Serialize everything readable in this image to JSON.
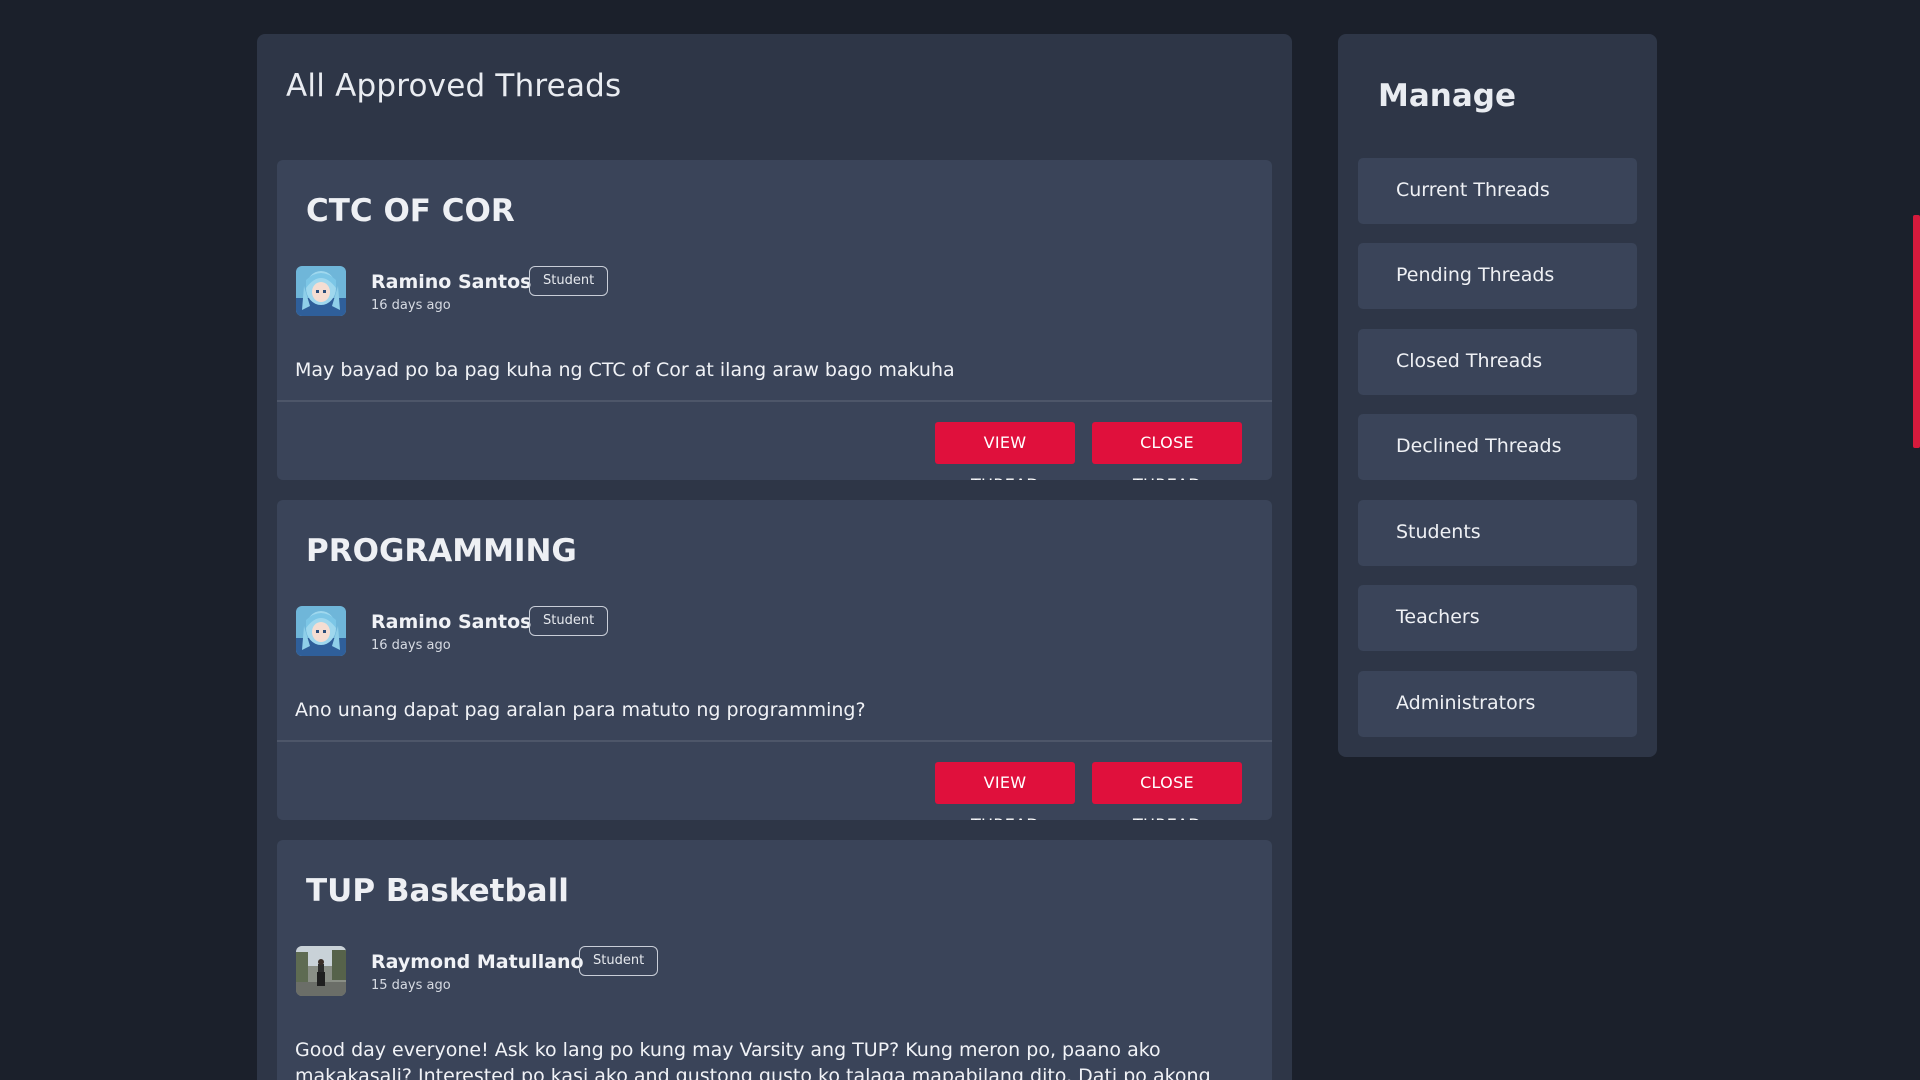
{
  "main": {
    "title": "All Approved Threads",
    "threads": [
      {
        "title": "CTC OF COR",
        "author": "Ramino Santos",
        "role": "Student",
        "time": "16 days ago",
        "body": "May bayad po ba pag kuha ng CTC of Cor at ilang araw bago makuha",
        "view_label": "VIEW THREAD",
        "close_label": "CLOSE THREAD"
      },
      {
        "title": "PROGRAMMING",
        "author": "Ramino Santos",
        "role": "Student",
        "time": "16 days ago",
        "body": "Ano unang dapat pag aralan para matuto ng programming?",
        "view_label": "VIEW THREAD",
        "close_label": "CLOSE THREAD"
      },
      {
        "title": "TUP Basketball",
        "author": "Raymond Matullano",
        "role": "Student",
        "time": "15 days ago",
        "body": "Good day everyone! Ask ko lang po kung may Varsity ang TUP? Kung meron po, paano ako makakasali? Interested po kasi ako and gustong gusto ko talaga mapabilang dito. Dati po akong"
      }
    ]
  },
  "sidebar": {
    "title": "Manage",
    "items": [
      {
        "label": "Current Threads"
      },
      {
        "label": "Pending Threads"
      },
      {
        "label": "Closed Threads"
      },
      {
        "label": "Declined Threads"
      },
      {
        "label": "Students"
      },
      {
        "label": "Teachers"
      },
      {
        "label": "Administrators"
      }
    ]
  },
  "colors": {
    "background": "#1b202b",
    "panel": "#2e3647",
    "card": "#3a4459",
    "accent": "#e0103c"
  },
  "icons": {
    "avatar_1": "anime-avatar-blue-hair",
    "avatar_2": "anime-avatar-blue-hair",
    "avatar_3": "photo-avatar-outdoor"
  }
}
